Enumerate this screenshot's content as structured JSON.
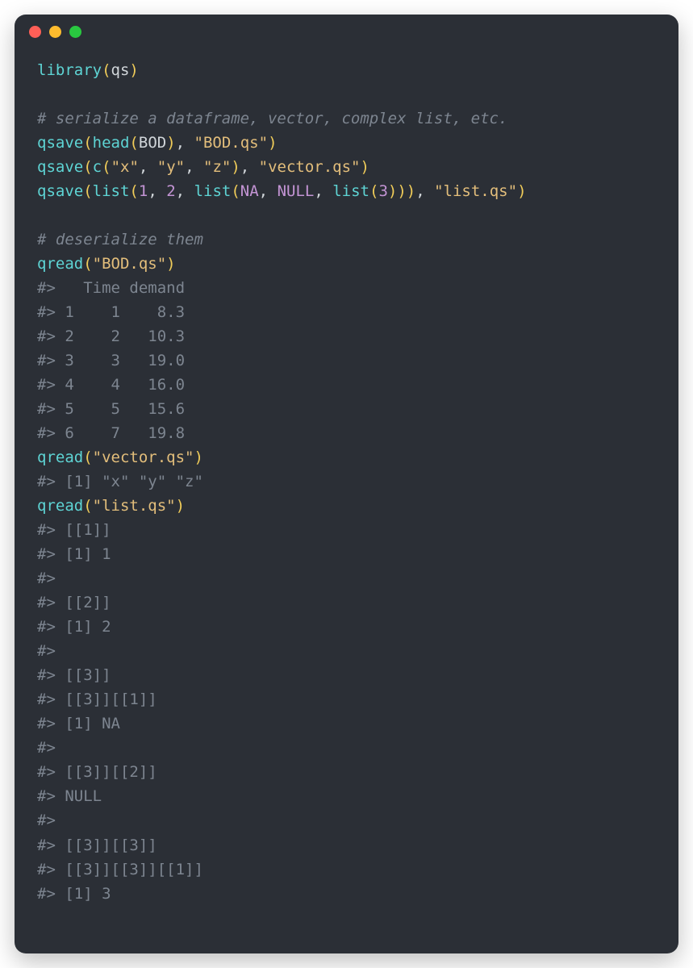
{
  "code": {
    "lines": [
      [
        {
          "cls": "fn",
          "t": "library"
        },
        {
          "cls": "paren",
          "t": "("
        },
        {
          "cls": "ident",
          "t": "qs"
        },
        {
          "cls": "paren",
          "t": ")"
        }
      ],
      [],
      [
        {
          "cls": "cmt",
          "t": "# serialize a dataframe, vector, complex list, etc."
        }
      ],
      [
        {
          "cls": "fn",
          "t": "qsave"
        },
        {
          "cls": "paren",
          "t": "("
        },
        {
          "cls": "fn",
          "t": "head"
        },
        {
          "cls": "paren",
          "t": "("
        },
        {
          "cls": "ident",
          "t": "BOD"
        },
        {
          "cls": "paren",
          "t": ")"
        },
        {
          "cls": "ident",
          "t": ", "
        },
        {
          "cls": "str",
          "t": "\"BOD.qs\""
        },
        {
          "cls": "paren",
          "t": ")"
        }
      ],
      [
        {
          "cls": "fn",
          "t": "qsave"
        },
        {
          "cls": "paren",
          "t": "("
        },
        {
          "cls": "fn",
          "t": "c"
        },
        {
          "cls": "paren",
          "t": "("
        },
        {
          "cls": "str",
          "t": "\"x\""
        },
        {
          "cls": "ident",
          "t": ", "
        },
        {
          "cls": "str",
          "t": "\"y\""
        },
        {
          "cls": "ident",
          "t": ", "
        },
        {
          "cls": "str",
          "t": "\"z\""
        },
        {
          "cls": "paren",
          "t": ")"
        },
        {
          "cls": "ident",
          "t": ", "
        },
        {
          "cls": "str",
          "t": "\"vector.qs\""
        },
        {
          "cls": "paren",
          "t": ")"
        }
      ],
      [
        {
          "cls": "fn",
          "t": "qsave"
        },
        {
          "cls": "paren",
          "t": "("
        },
        {
          "cls": "fn",
          "t": "list"
        },
        {
          "cls": "paren",
          "t": "("
        },
        {
          "cls": "num",
          "t": "1"
        },
        {
          "cls": "ident",
          "t": ", "
        },
        {
          "cls": "num",
          "t": "2"
        },
        {
          "cls": "ident",
          "t": ", "
        },
        {
          "cls": "fn",
          "t": "list"
        },
        {
          "cls": "paren",
          "t": "("
        },
        {
          "cls": "const",
          "t": "NA"
        },
        {
          "cls": "ident",
          "t": ", "
        },
        {
          "cls": "const",
          "t": "NULL"
        },
        {
          "cls": "ident",
          "t": ", "
        },
        {
          "cls": "fn",
          "t": "list"
        },
        {
          "cls": "paren",
          "t": "("
        },
        {
          "cls": "num",
          "t": "3"
        },
        {
          "cls": "paren",
          "t": ")))"
        },
        {
          "cls": "ident",
          "t": ", "
        },
        {
          "cls": "str",
          "t": "\"list.qs\""
        },
        {
          "cls": "paren",
          "t": ")"
        }
      ],
      [],
      [
        {
          "cls": "cmt",
          "t": "# deserialize them"
        }
      ],
      [
        {
          "cls": "fn",
          "t": "qread"
        },
        {
          "cls": "paren",
          "t": "("
        },
        {
          "cls": "str",
          "t": "\"BOD.qs\""
        },
        {
          "cls": "paren",
          "t": ")"
        }
      ],
      [
        {
          "cls": "out",
          "t": "#>   Time demand"
        }
      ],
      [
        {
          "cls": "out",
          "t": "#> 1    1    8.3"
        }
      ],
      [
        {
          "cls": "out",
          "t": "#> 2    2   10.3"
        }
      ],
      [
        {
          "cls": "out",
          "t": "#> 3    3   19.0"
        }
      ],
      [
        {
          "cls": "out",
          "t": "#> 4    4   16.0"
        }
      ],
      [
        {
          "cls": "out",
          "t": "#> 5    5   15.6"
        }
      ],
      [
        {
          "cls": "out",
          "t": "#> 6    7   19.8"
        }
      ],
      [
        {
          "cls": "fn",
          "t": "qread"
        },
        {
          "cls": "paren",
          "t": "("
        },
        {
          "cls": "str",
          "t": "\"vector.qs\""
        },
        {
          "cls": "paren",
          "t": ")"
        }
      ],
      [
        {
          "cls": "out",
          "t": "#> [1] \"x\" \"y\" \"z\""
        }
      ],
      [
        {
          "cls": "fn",
          "t": "qread"
        },
        {
          "cls": "paren",
          "t": "("
        },
        {
          "cls": "str",
          "t": "\"list.qs\""
        },
        {
          "cls": "paren",
          "t": ")"
        }
      ],
      [
        {
          "cls": "out",
          "t": "#> [[1]]"
        }
      ],
      [
        {
          "cls": "out",
          "t": "#> [1] 1"
        }
      ],
      [
        {
          "cls": "out",
          "t": "#> "
        }
      ],
      [
        {
          "cls": "out",
          "t": "#> [[2]]"
        }
      ],
      [
        {
          "cls": "out",
          "t": "#> [1] 2"
        }
      ],
      [
        {
          "cls": "out",
          "t": "#> "
        }
      ],
      [
        {
          "cls": "out",
          "t": "#> [[3]]"
        }
      ],
      [
        {
          "cls": "out",
          "t": "#> [[3]][[1]]"
        }
      ],
      [
        {
          "cls": "out",
          "t": "#> [1] NA"
        }
      ],
      [
        {
          "cls": "out",
          "t": "#> "
        }
      ],
      [
        {
          "cls": "out",
          "t": "#> [[3]][[2]]"
        }
      ],
      [
        {
          "cls": "out",
          "t": "#> NULL"
        }
      ],
      [
        {
          "cls": "out",
          "t": "#> "
        }
      ],
      [
        {
          "cls": "out",
          "t": "#> [[3]][[3]]"
        }
      ],
      [
        {
          "cls": "out",
          "t": "#> [[3]][[3]][[1]]"
        }
      ],
      [
        {
          "cls": "out",
          "t": "#> [1] 3"
        }
      ]
    ]
  }
}
